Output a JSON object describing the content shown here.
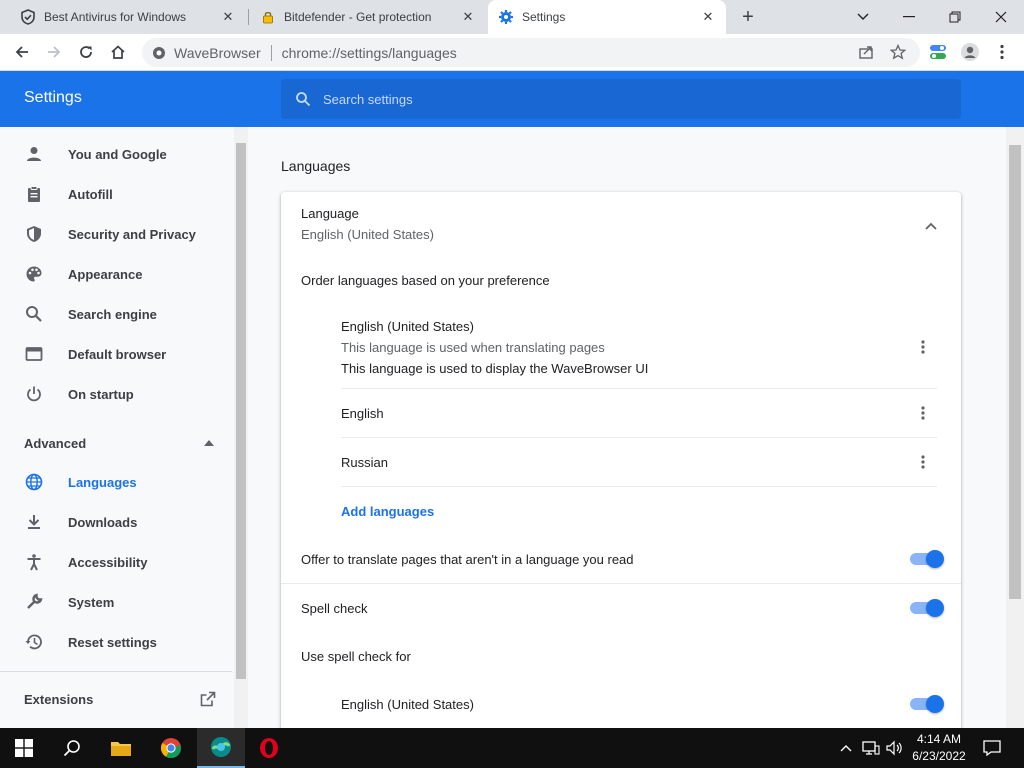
{
  "browser": {
    "tabs": [
      {
        "title": "Best Antivirus for Windows",
        "icon": "shield-check-icon",
        "active": false
      },
      {
        "title": "Bitdefender - Get protection",
        "icon": "lock-icon",
        "active": false
      },
      {
        "title": "Settings",
        "icon": "gear-icon",
        "active": true
      }
    ],
    "site_name": "WaveBrowser",
    "url": "chrome://settings/languages"
  },
  "header": {
    "title": "Settings",
    "search_placeholder": "Search settings"
  },
  "sidebar": {
    "items": [
      {
        "label": "You and Google",
        "icon": "person-icon"
      },
      {
        "label": "Autofill",
        "icon": "clipboard-icon"
      },
      {
        "label": "Security and Privacy",
        "icon": "shield-icon"
      },
      {
        "label": "Appearance",
        "icon": "palette-icon"
      },
      {
        "label": "Search engine",
        "icon": "search-icon"
      },
      {
        "label": "Default browser",
        "icon": "browser-window-icon"
      },
      {
        "label": "On startup",
        "icon": "power-icon"
      }
    ],
    "advanced_label": "Advanced",
    "advanced_items": [
      {
        "label": "Languages",
        "icon": "globe-icon",
        "selected": true
      },
      {
        "label": "Downloads",
        "icon": "download-icon"
      },
      {
        "label": "Accessibility",
        "icon": "accessibility-icon"
      },
      {
        "label": "System",
        "icon": "wrench-icon"
      },
      {
        "label": "Reset settings",
        "icon": "restore-icon"
      }
    ],
    "extensions_label": "Extensions"
  },
  "main": {
    "section_title": "Languages",
    "language_label": "Language",
    "language_value": "English (United States)",
    "order_label": "Order languages based on your preference",
    "languages": [
      {
        "name": "English (United States)",
        "note1": "This language is used when translating pages",
        "note2": "This language is used to display the WaveBrowser UI"
      },
      {
        "name": "English"
      },
      {
        "name": "Russian"
      }
    ],
    "add_languages": "Add languages",
    "offer_translate": "Offer to translate pages that aren't in a language you read",
    "offer_translate_on": true,
    "spell_check": "Spell check",
    "spell_check_on": true,
    "use_spell_check_for": "Use spell check for",
    "spell_lang": "English (United States)",
    "spell_lang_on": true
  },
  "taskbar": {
    "time": "4:14 AM",
    "date": "6/23/2022"
  },
  "colors": {
    "accent": "#1a73e8",
    "header_bg": "#1a73e8",
    "taskbar_bg": "#101010"
  }
}
